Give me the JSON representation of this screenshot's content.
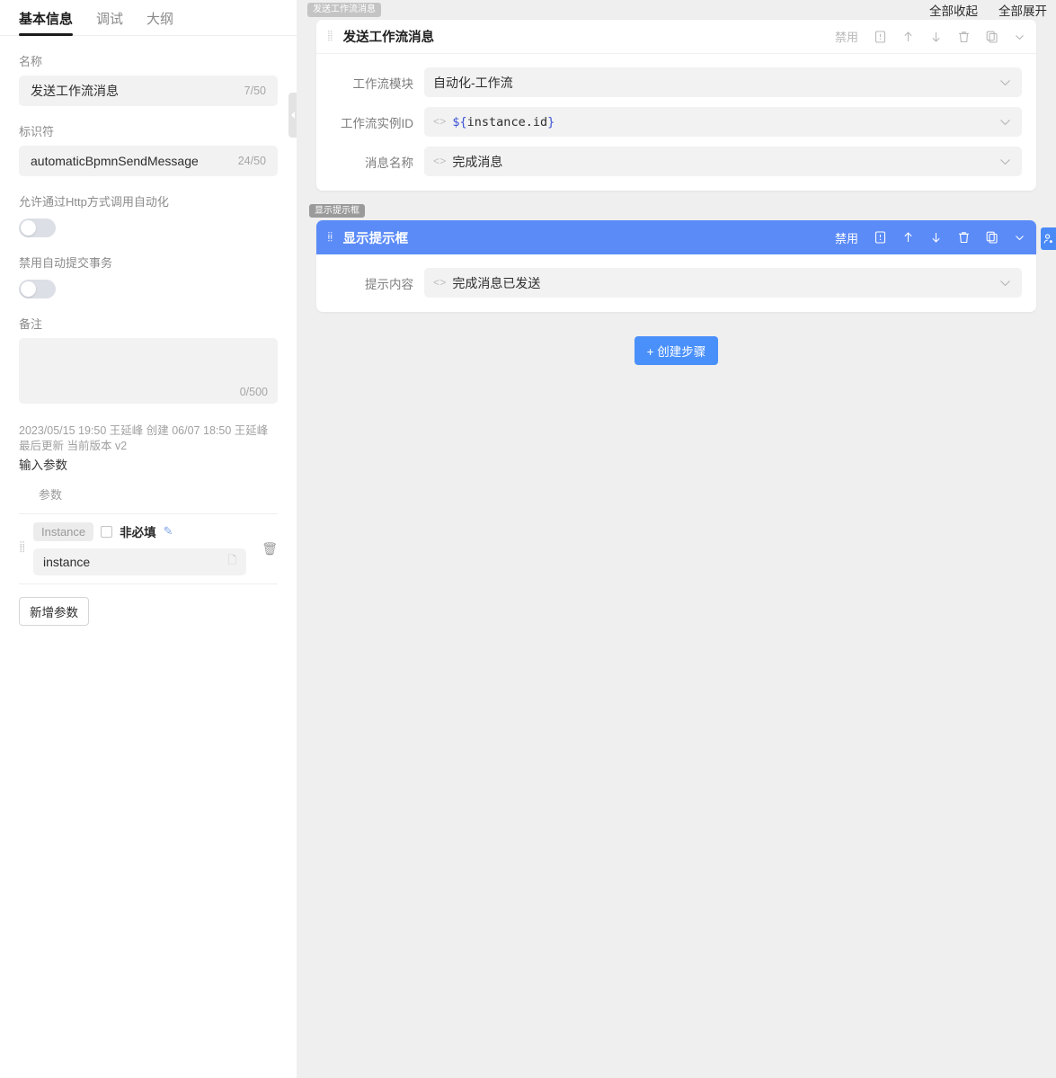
{
  "left": {
    "tabs": [
      {
        "label": "基本信息",
        "active": true
      },
      {
        "label": "调试",
        "active": false
      },
      {
        "label": "大纲",
        "active": false
      }
    ],
    "name_label": "名称",
    "name_value": "发送工作流消息",
    "name_counter": "7/50",
    "identifier_label": "标识符",
    "identifier_value": "automaticBpmnSendMessage",
    "identifier_counter": "24/50",
    "http_toggle_label": "允许通过Http方式调用自动化",
    "http_toggle_state": "off",
    "autocommit_toggle_label": "禁用自动提交事务",
    "autocommit_toggle_state": "off",
    "remark_label": "备注",
    "remark_value": "",
    "remark_counter": "0/500",
    "meta_text": "2023/05/15 19:50 王延峰 创建 06/07 18:50 王延峰 最后更新 当前版本 v2",
    "input_params_title": "输入参数",
    "params_column_header": "参数",
    "params": [
      {
        "chip": "Instance",
        "optional_label": "非必填",
        "optional_checked": false,
        "edit_icon": "pencil-icon",
        "value": "instance",
        "doc_icon": "doc-icon",
        "delete_icon": "trash-icon"
      }
    ],
    "add_param_button": "新增参数",
    "collapse_handle_icon": "chevron-left-icon"
  },
  "right": {
    "collapse_all": "全部收起",
    "expand_all": "全部展开",
    "side_tab_icon": "user-icon",
    "add_step_button": "+ 创建步骤",
    "cards": [
      {
        "tag": "发送工作流消息",
        "title": "发送工作流消息",
        "selected": false,
        "tools": {
          "disable_label": "禁用",
          "icons": [
            "note-icon",
            "arrow-up-icon",
            "arrow-down-icon",
            "trash-icon",
            "copy-icon",
            "chevron-down-icon"
          ]
        },
        "fields": [
          {
            "label": "工作流模块",
            "value": "自动化-工作流",
            "code_icon": false,
            "mono": false
          },
          {
            "label": "工作流实例ID",
            "value": "${instance.id}",
            "code_icon": true,
            "mono": true
          },
          {
            "label": "消息名称",
            "value": "完成消息",
            "code_icon": true,
            "mono": false
          }
        ]
      },
      {
        "tag": "显示提示框",
        "title": "显示提示框",
        "selected": true,
        "tools": {
          "disable_label": "禁用",
          "icons": [
            "note-icon",
            "arrow-up-icon",
            "arrow-down-icon",
            "trash-icon",
            "copy-icon",
            "chevron-down-icon"
          ]
        },
        "fields": [
          {
            "label": "提示内容",
            "value": "完成消息已发送",
            "code_icon": true,
            "mono": false
          }
        ]
      }
    ]
  },
  "colors": {
    "accent_blue": "#5b8bf7",
    "button_blue": "#4a90fb",
    "panel_bg": "#efefef",
    "input_bg": "#f2f2f2"
  }
}
